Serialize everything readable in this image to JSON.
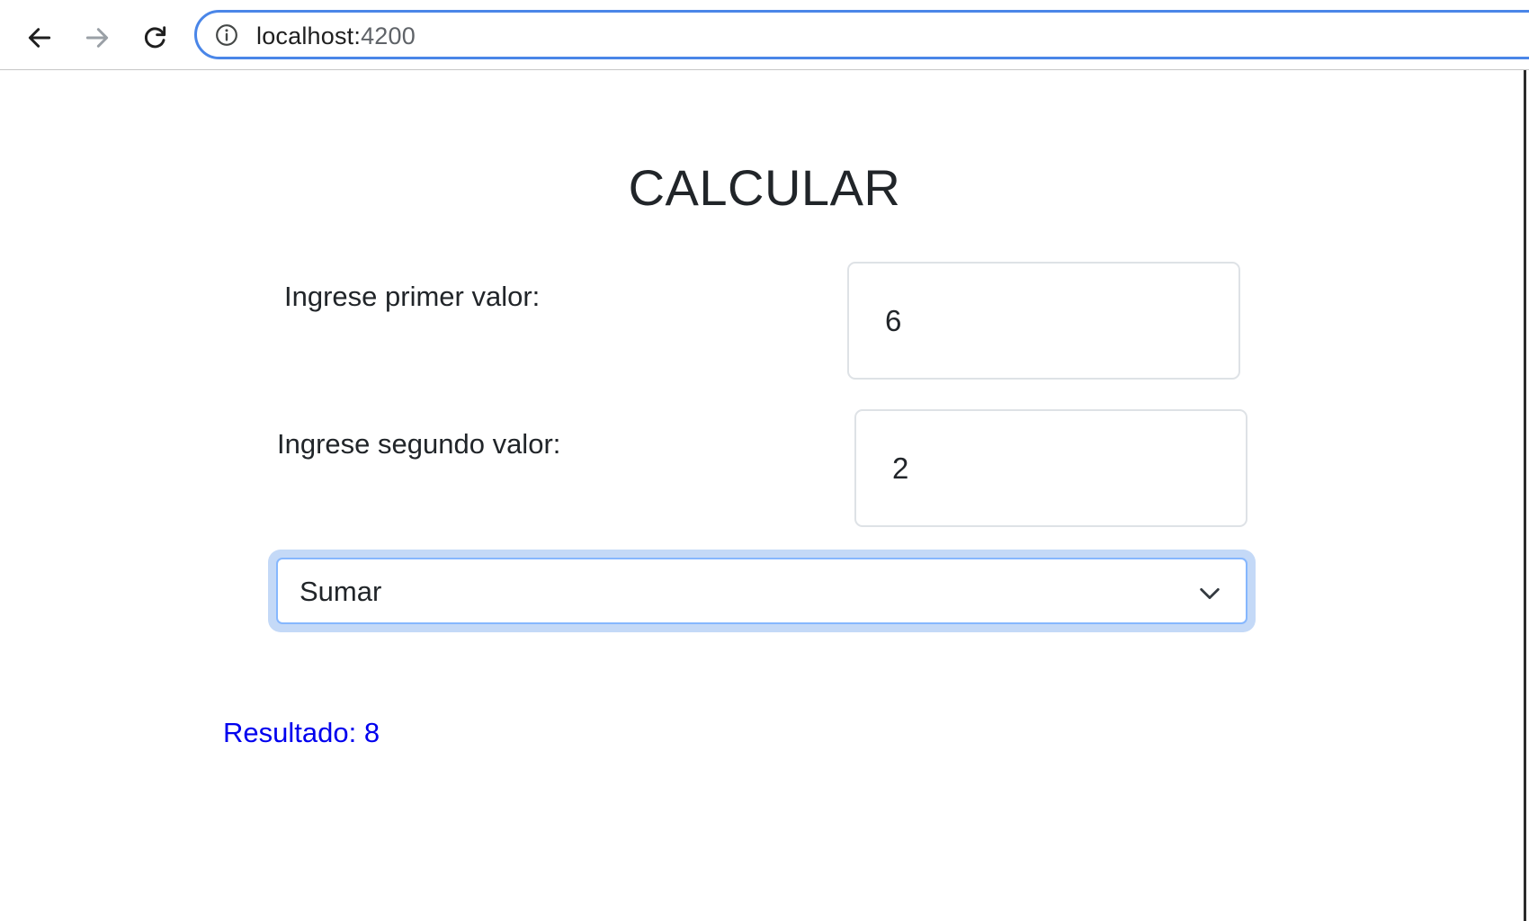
{
  "browser": {
    "url_host": "localhost:",
    "url_port": "4200",
    "accent_color": "#4a86e8",
    "icons": [
      "back-arrow-icon",
      "forward-arrow-icon",
      "reload-icon",
      "info-icon"
    ]
  },
  "page": {
    "title": "CALCULAR",
    "first_label": "Ingrese primer valor:",
    "first_value": "6",
    "second_label": "Ingrese segundo valor:",
    "second_value": "2",
    "operation": {
      "selected": "Sumar",
      "icon": "chevron-down-icon"
    },
    "result_text": "Resultado: 8",
    "result_color": "#0000ee"
  }
}
